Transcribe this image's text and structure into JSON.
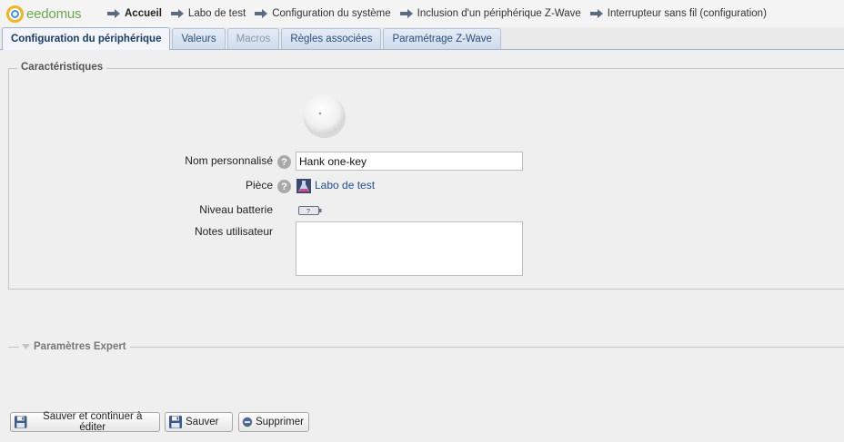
{
  "app": {
    "logo_text": "eedomus"
  },
  "breadcrumb": [
    {
      "label": "Accueil",
      "strong": true
    },
    {
      "label": "Labo de test",
      "strong": false
    },
    {
      "label": "Configuration du système",
      "strong": false
    },
    {
      "label": "Inclusion d'un périphérique Z-Wave",
      "strong": false
    },
    {
      "label": "Interrupteur sans fil (configuration)",
      "strong": false
    }
  ],
  "tabs": [
    {
      "label": "Configuration du périphérique",
      "state": "active"
    },
    {
      "label": "Valeurs",
      "state": "normal"
    },
    {
      "label": "Macros",
      "state": "disabled"
    },
    {
      "label": "Règles associées",
      "state": "normal"
    },
    {
      "label": "Paramétrage Z-Wave",
      "state": "normal"
    }
  ],
  "characteristics": {
    "legend": "Caractéristiques",
    "name_label": "Nom personnalisé",
    "name_value": "Hank one-key",
    "room_label": "Pièce",
    "room_value": "Labo de test",
    "battery_label": "Niveau batterie",
    "battery_text": "?",
    "notes_label": "Notes utilisateur",
    "notes_value": "",
    "help_glyph": "?"
  },
  "expert": {
    "title": "Paramètres Expert",
    "collapsed": true
  },
  "buttons": {
    "save_continue": "Sauver et continuer à éditer",
    "save": "Sauver",
    "delete": "Supprimer"
  },
  "colors": {
    "accent": "#2d4f78",
    "link": "#1f4f8f",
    "logo_text": "#6aa84f",
    "logo_ring_outer": "#f2b51c",
    "logo_ring_inner": "#3a9bd9",
    "arrow": "#5a6b82"
  },
  "icons": {
    "logo": "eedomus-ring-icon",
    "crumb": "arrow-right-icon",
    "help": "question-circle-icon",
    "room": "lab-flask-icon",
    "battery": "battery-icon",
    "expert": "caret-down-icon",
    "save": "floppy-disk-icon",
    "delete": "minus-circle-icon"
  }
}
